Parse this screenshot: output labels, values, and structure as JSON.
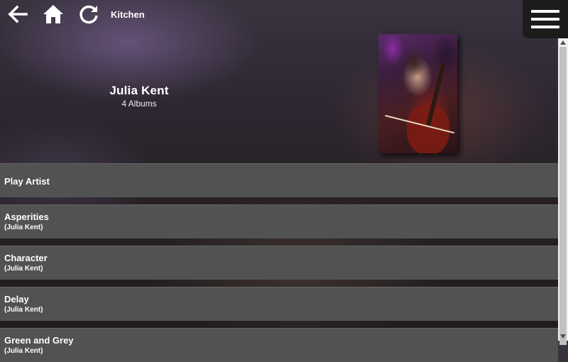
{
  "header": {
    "room": "Kitchen",
    "icons": [
      "back-arrow-icon",
      "home-icon",
      "refresh-icon",
      "hamburger-menu-icon"
    ]
  },
  "artist": {
    "name": "Julia Kent",
    "album_count": "4 Albums"
  },
  "list": {
    "play_artist": "Play Artist",
    "albums": [
      {
        "title": "Asperities",
        "artist": "(Julia Kent)"
      },
      {
        "title": "Character",
        "artist": "(Julia Kent)"
      },
      {
        "title": "Delay",
        "artist": "(Julia Kent)"
      },
      {
        "title": "Green and Grey",
        "artist": "(Julia Kent)"
      }
    ]
  }
}
